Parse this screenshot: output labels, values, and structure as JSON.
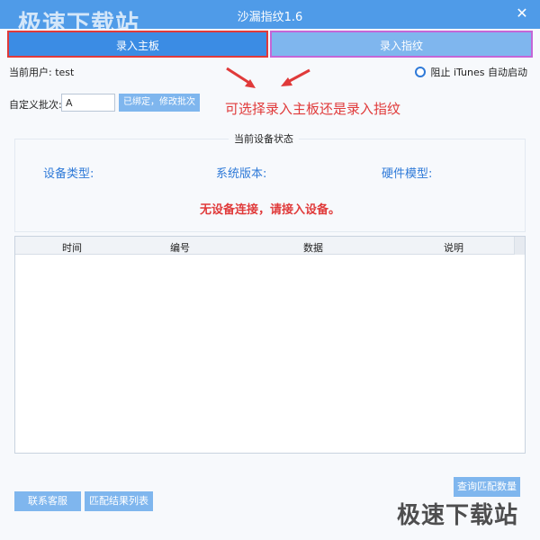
{
  "app": {
    "title": "沙漏指纹1.6",
    "close_glyph": "✕",
    "watermark_top": "极速下载站",
    "watermark_bottom": "极速下载站"
  },
  "tabs": [
    {
      "label": "录入主板",
      "active": true
    },
    {
      "label": "录入指纹",
      "active": false
    }
  ],
  "user": {
    "label": "当前用户: test"
  },
  "itunes_option": {
    "label": "阻止 iTunes 自动启动"
  },
  "batch": {
    "label": "自定义批次:",
    "value": "A",
    "button_label": "已绑定，修改批次"
  },
  "annotation": "可选择录入主板还是录入指纹",
  "device_status": {
    "title": "当前设备状态",
    "fields": [
      "设备类型:",
      "系统版本:",
      "硬件模型:"
    ],
    "message": "无设备连接，请接入设备。"
  },
  "table": {
    "columns": [
      "时间",
      "编号",
      "数据",
      "说明"
    ],
    "rows": []
  },
  "buttons": {
    "query": "查询匹配数量",
    "contact": "联系客服",
    "results": "匹配结果列表"
  },
  "colors": {
    "accent": "#4f9be8",
    "highlight_red": "#e03a3a",
    "highlight_purple": "#c466d6",
    "status_blue": "#2f7ad8"
  }
}
